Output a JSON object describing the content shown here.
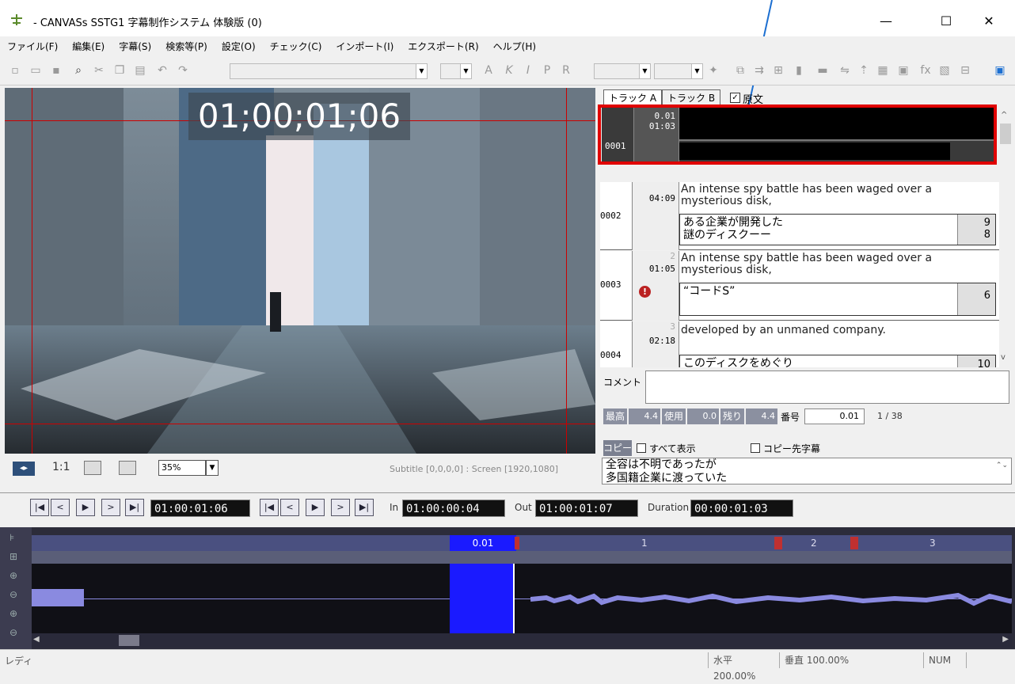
{
  "window": {
    "title": "- CANVASs SSTG1 字幕制作システム 体験版 (0)"
  },
  "menu": [
    "ファイル(F)",
    "編集(E)",
    "字幕(S)",
    "検索等(P)",
    "設定(O)",
    "チェック(C)",
    "インポート(I)",
    "エクスポート(R)",
    "ヘルプ(H)"
  ],
  "video": {
    "timecode": "01;00;01;06",
    "scale_label": "1:1",
    "zoom": "35%",
    "status": "Subtitle [0,0,0,0] : Screen [1920,1080]"
  },
  "tabs": {
    "track_a": "トラック A",
    "track_b": "トラック B",
    "original": "原文"
  },
  "subtitles": [
    {
      "num": "0001",
      "dur": "0.01",
      "tc": "01:03",
      "src": "",
      "trans": "",
      "count": ""
    },
    {
      "num": "0002",
      "dur": "",
      "tc": "04:09",
      "src": "An intense spy battle has been waged over a mysterious disk,",
      "trans": "ある企業が開発した\n謎のディスクーー",
      "count": "9\n8"
    },
    {
      "num": "0003",
      "dur": "2",
      "tc": "01:05",
      "src": "An intense spy battle has been waged over a mysterious disk,",
      "trans": "“コードS”",
      "count": "6"
    },
    {
      "num": "0004",
      "dur": "3",
      "tc": "02:18",
      "src": "developed by an unmaned company.",
      "trans": "このディスクをめぐり",
      "count": "10"
    }
  ],
  "comment": {
    "label": "コメント",
    "value": ""
  },
  "stats": {
    "max_label": "最高",
    "max": "4.4",
    "used_label": "使用",
    "used": "0.0",
    "remain_label": "残り",
    "remain": "4.4",
    "num_label": "番号",
    "num": "0.01",
    "page": "1 / 38"
  },
  "copy": {
    "button": "コピー",
    "show_all": "すべて表示",
    "copy_dest": "コピー先字幕",
    "text": "全容は不明であったが\n多国籍企業に渡っていた"
  },
  "transport": {
    "tc_main": "01:00:01:06",
    "in_label": "In",
    "in": "01:00:00:04",
    "out_label": "Out",
    "out": "01:00:01:07",
    "duration_label": "Duration",
    "duration": "00:00:01:03"
  },
  "timeline": {
    "segments": [
      "0.01",
      "1",
      "2",
      "3"
    ]
  },
  "status": {
    "left": "レディ",
    "horizontal": "水平 200.00%",
    "vertical": "垂直 100.00%",
    "num": "NUM"
  },
  "colors": {
    "highlight": "#e00000",
    "arrow": "#1c6fd1",
    "timeline_sel": "#1a1aff"
  }
}
